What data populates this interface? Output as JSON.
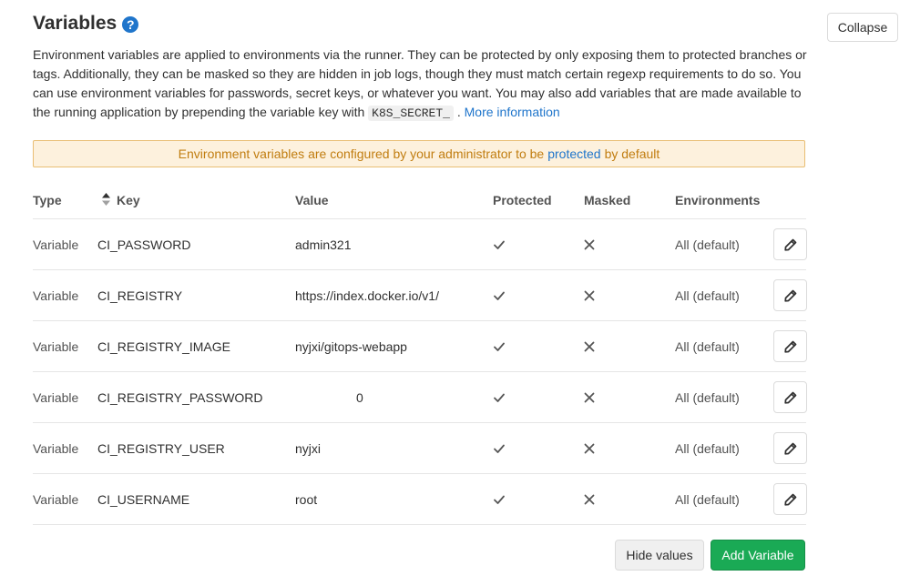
{
  "header": {
    "title": "Variables",
    "help_icon": "question-circle-icon",
    "help_glyph": "?",
    "collapse_label": "Collapse"
  },
  "description": {
    "text": "Environment variables are applied to environments via the runner. They can be protected by only exposing them to protected branches or tags. Additionally, they can be masked so they are hidden in job logs, though they must match certain regexp requirements to do so. You can use environment variables for passwords, secret keys, or whatever you want. You may also add variables that are made available to the running application by prepending the variable key with",
    "code": "K8S_SECRET_",
    "after_code": ".",
    "link": "More information"
  },
  "alert": {
    "before": "Environment variables are configured by your administrator to be",
    "link": "protected",
    "after": "by default"
  },
  "columns": {
    "type": "Type",
    "key": "Key",
    "value": "Value",
    "protected": "Protected",
    "masked": "Masked",
    "environments": "Environments"
  },
  "rows": [
    {
      "type": "Variable",
      "key": "CI_PASSWORD",
      "value": "admin321",
      "env": "All (default)"
    },
    {
      "type": "Variable",
      "key": "CI_REGISTRY",
      "value": "https://index.docker.io/v1/",
      "env": "All (default)"
    },
    {
      "type": "Variable",
      "key": "CI_REGISTRY_IMAGE",
      "value": "nyjxi/gitops-webapp",
      "env": "All (default)"
    },
    {
      "type": "Variable",
      "key": "CI_REGISTRY_PASSWORD",
      "value": "0",
      "env": "All (default)"
    },
    {
      "type": "Variable",
      "key": "CI_REGISTRY_USER",
      "value": "nyjxi",
      "env": "All (default)"
    },
    {
      "type": "Variable",
      "key": "CI_USERNAME",
      "value": "root",
      "env": "All (default)"
    }
  ],
  "icons": {
    "protected": "check-icon",
    "masked": "close-icon",
    "edit": "pencil-icon",
    "sort": "sort-icon"
  },
  "footer": {
    "hide_label": "Hide values",
    "add_label": "Add Variable"
  },
  "colors": {
    "link": "#1f75cb",
    "alert_bg": "#fdf1dd",
    "alert_text": "#c17d10",
    "add_button": "#1aaa55"
  }
}
